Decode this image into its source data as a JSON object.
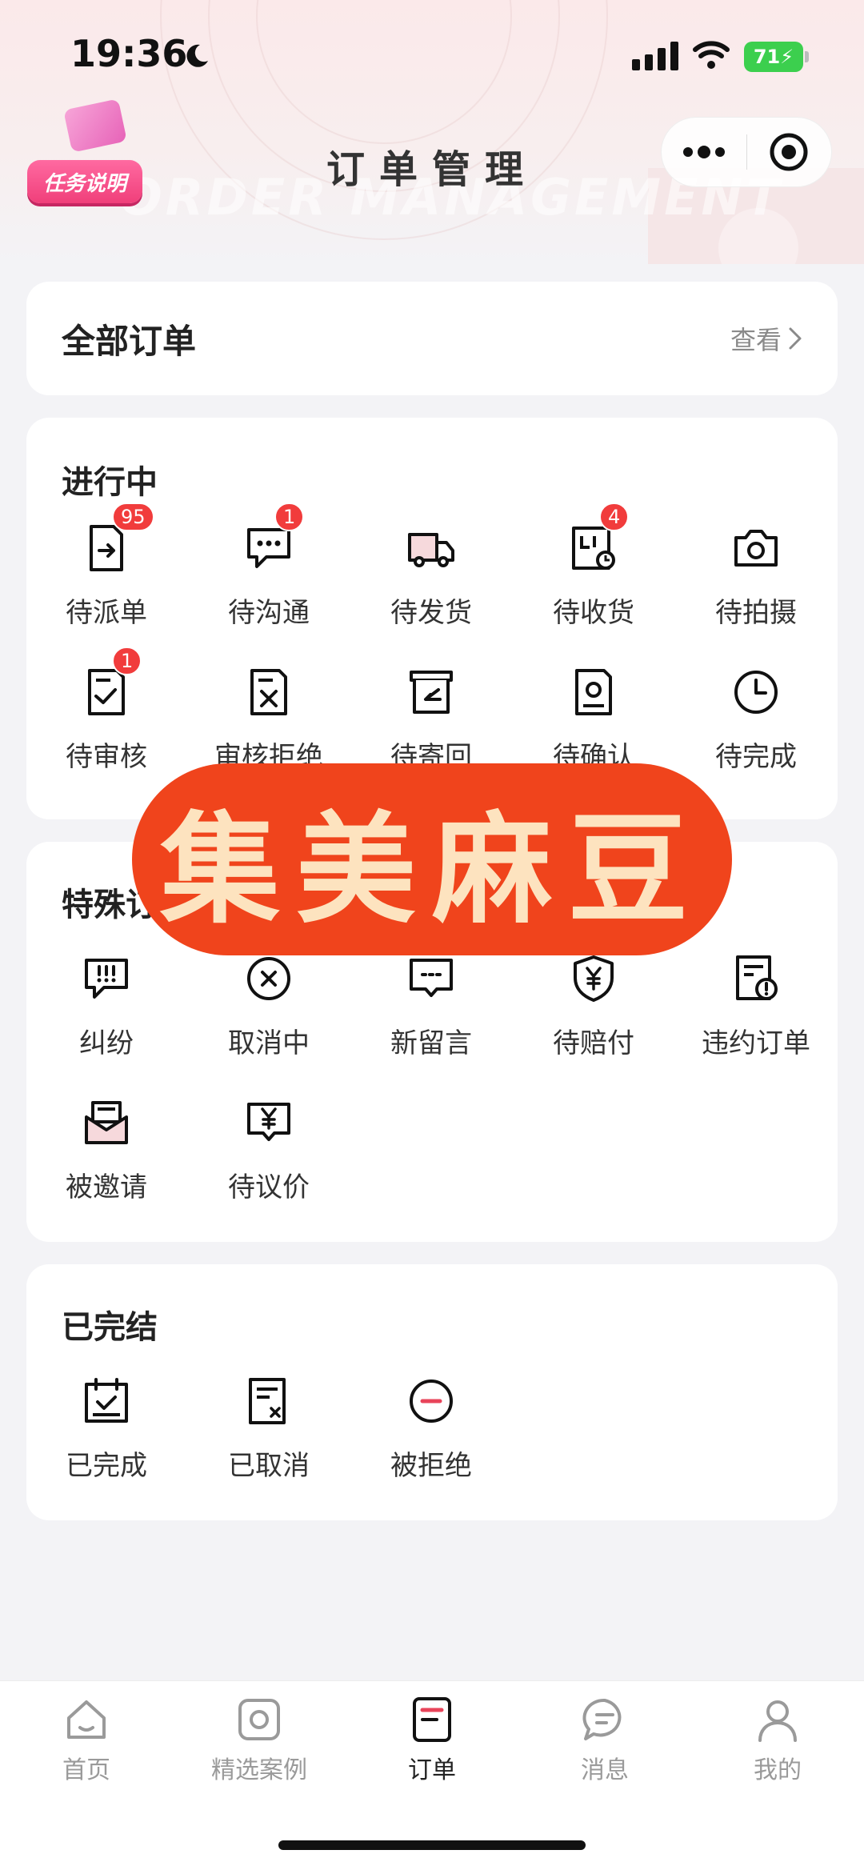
{
  "status_bar": {
    "time": "19:36",
    "battery": "71"
  },
  "header": {
    "title": "订单管理",
    "watermark": "ORDER MANAGEMENT",
    "task_button_label": "任务说明"
  },
  "all_orders": {
    "title": "全部订单",
    "view_label": "查看"
  },
  "in_progress": {
    "title": "进行中",
    "items": [
      {
        "label": "待派单",
        "icon": "document-arrow-icon",
        "badge": "95"
      },
      {
        "label": "待沟通",
        "icon": "chat-dots-icon",
        "badge": "1"
      },
      {
        "label": "待发货",
        "icon": "truck-icon",
        "badge": ""
      },
      {
        "label": "待收货",
        "icon": "package-icon",
        "badge": "4"
      },
      {
        "label": "待拍摄",
        "icon": "camera-icon",
        "badge": ""
      },
      {
        "label": "待审核",
        "icon": "document-check-icon",
        "badge": "1"
      },
      {
        "label": "审核拒绝",
        "icon": "document-x-icon",
        "badge": ""
      },
      {
        "label": "待寄回",
        "icon": "return-box-icon",
        "badge": ""
      },
      {
        "label": "待确认",
        "icon": "document-user-icon",
        "badge": ""
      },
      {
        "label": "待完成",
        "icon": "clock-icon",
        "badge": ""
      }
    ]
  },
  "special": {
    "title": "特殊订",
    "items": [
      {
        "label": "纠纷",
        "icon": "alert-chat-icon"
      },
      {
        "label": "取消中",
        "icon": "cancel-circle-icon"
      },
      {
        "label": "新留言",
        "icon": "message-icon"
      },
      {
        "label": "待赔付",
        "icon": "shield-yen-icon"
      },
      {
        "label": "违约订单",
        "icon": "document-warning-icon"
      },
      {
        "label": "被邀请",
        "icon": "envelope-icon"
      },
      {
        "label": "待议价",
        "icon": "yen-chat-icon"
      }
    ]
  },
  "finished": {
    "title": "已完结",
    "items": [
      {
        "label": "已完成",
        "icon": "calendar-check-icon"
      },
      {
        "label": "已取消",
        "icon": "document-cancel-icon"
      },
      {
        "label": "被拒绝",
        "icon": "minus-circle-icon"
      }
    ]
  },
  "overlay_stamp": "集美麻豆",
  "tab_bar": {
    "items": [
      {
        "label": "首页",
        "icon": "home-icon",
        "active": false
      },
      {
        "label": "精选案例",
        "icon": "camera-square-icon",
        "active": false
      },
      {
        "label": "订单",
        "icon": "order-icon",
        "active": true
      },
      {
        "label": "消息",
        "icon": "chat-icon",
        "active": false
      },
      {
        "label": "我的",
        "icon": "user-icon",
        "active": false
      }
    ]
  },
  "colors": {
    "badge": "#f13c3c",
    "stamp": "#f0441c",
    "stamp_text": "#fde3bf",
    "task_pink": "#f03f7a"
  }
}
